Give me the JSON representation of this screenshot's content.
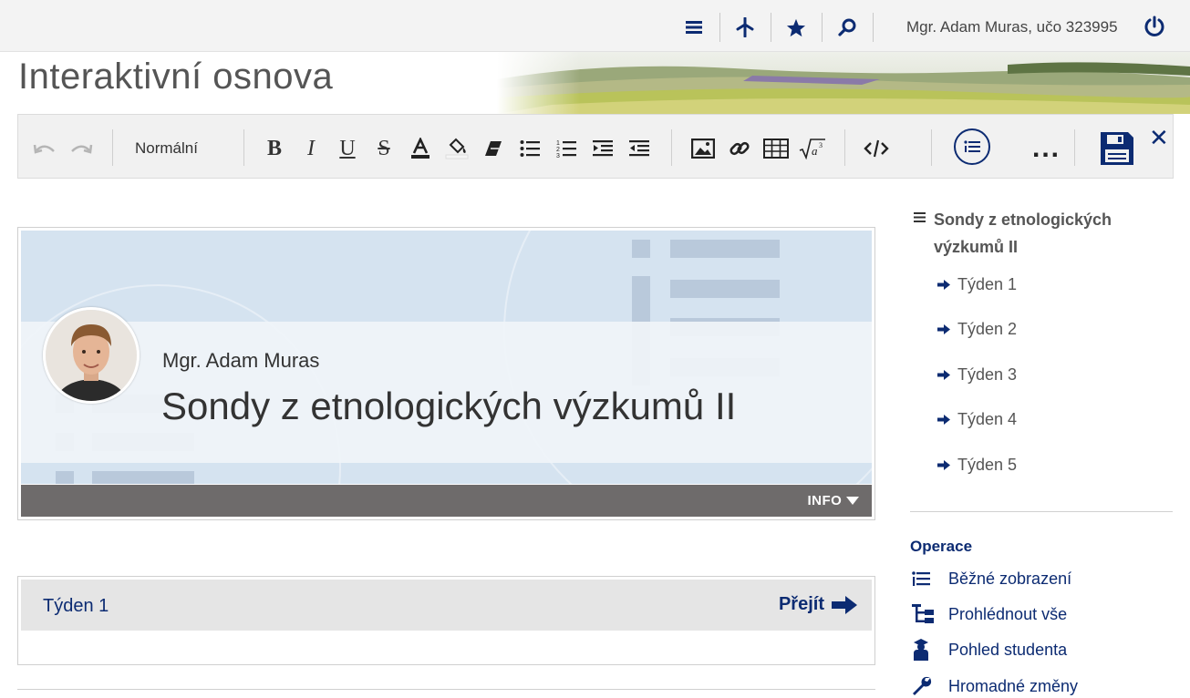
{
  "header": {
    "user": "Mgr. Adam Muras, učo 323995",
    "page_title": "Interaktivní osnova"
  },
  "toolbar": {
    "format": "Normální",
    "icons": [
      "undo-icon",
      "redo-icon",
      "bold-icon",
      "italic-icon",
      "underline-icon",
      "strikethrough-icon",
      "text-color-icon",
      "highlight-icon",
      "clear-format-icon",
      "bullet-list-icon",
      "numbered-list-icon",
      "indent-icon",
      "outdent-icon",
      "image-icon",
      "link-icon",
      "table-icon",
      "math-icon",
      "code-icon",
      "outline-icon",
      "more-icon",
      "save-icon",
      "close-icon"
    ],
    "dots": "..."
  },
  "course": {
    "teacher": "Mgr. Adam Muras",
    "title": "Sondy z etnologických výzkumů II",
    "info": "INFO"
  },
  "week": {
    "name": "Týden 1",
    "go": "Přejít"
  },
  "sidebar": {
    "toc_title": "Sondy z etnologických výzkumů II",
    "items": [
      "Týden 1",
      "Týden 2",
      "Týden 3",
      "Týden 4",
      "Týden 5"
    ],
    "ops_title": "Operace",
    "ops": [
      "Běžné zobrazení",
      "Prohlédnout vše",
      "Pohled studenta",
      "Hromadné změny"
    ]
  },
  "colors": {
    "accent": "#0c2b72",
    "hero": "#d5e3f0",
    "infobar": "#6e6b6b",
    "toolbar": "#f1f1f1"
  }
}
